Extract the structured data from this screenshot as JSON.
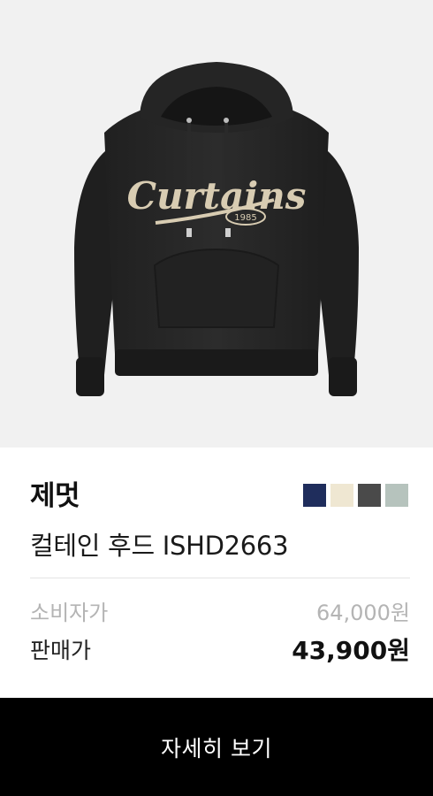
{
  "product": {
    "brand": "제멋",
    "name": "컬테인 후드 ISHD2663",
    "image_text": {
      "logo": "Curtains",
      "year": "1985"
    },
    "image_icon": "hoodie-product-photo"
  },
  "swatches": [
    {
      "name": "navy",
      "color": "#1f2d5c"
    },
    {
      "name": "cream",
      "color": "#efe7d2"
    },
    {
      "name": "charcoal",
      "color": "#4a4a4a"
    },
    {
      "name": "sage",
      "color": "#b6c3bd"
    }
  ],
  "pricing": {
    "retail_label": "소비자가",
    "retail_price": "64,000원",
    "sale_label": "판매가",
    "sale_price": "43,900원"
  },
  "cta": {
    "label": "자세히 보기"
  },
  "colors": {
    "image_bg": "#f1f1f1",
    "button_bg": "#000000",
    "muted_text": "#b4b4b4"
  }
}
